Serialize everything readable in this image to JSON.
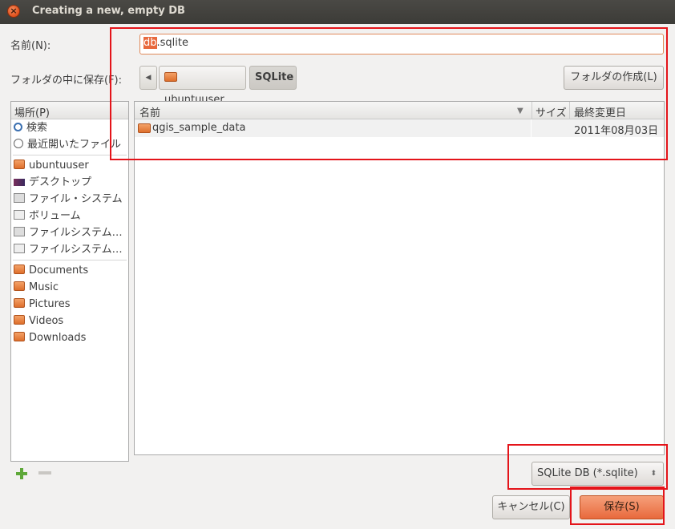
{
  "window": {
    "title": "Creating a new, empty DB",
    "close_icon": "×"
  },
  "name_field": {
    "label": "名前(N):",
    "selected_part": "db",
    "rest": ".sqlite"
  },
  "save_in": {
    "label": "フォルダの中に保存(F):",
    "crumbs": [
      "ubuntuuser",
      "SQLite"
    ],
    "create_folder_label": "フォルダの作成(L)"
  },
  "places": {
    "header": "場所(P)",
    "items": [
      {
        "label": "検索",
        "icon": "search-icon"
      },
      {
        "label": "最近開いたファイル",
        "icon": "recent-icon"
      },
      {
        "label": "ubuntuuser",
        "icon": "home-folder-icon"
      },
      {
        "label": "デスクトップ",
        "icon": "desktop-icon"
      },
      {
        "label": "ファイル・システム",
        "icon": "drive-icon"
      },
      {
        "label": "ボリューム",
        "icon": "usb-drive-icon"
      },
      {
        "label": "ファイルシステム…",
        "icon": "drive-icon"
      },
      {
        "label": "ファイルシステム…",
        "icon": "usb-drive-icon"
      },
      {
        "label": "Documents",
        "icon": "documents-folder-icon"
      },
      {
        "label": "Music",
        "icon": "music-folder-icon"
      },
      {
        "label": "Pictures",
        "icon": "pictures-folder-icon"
      },
      {
        "label": "Videos",
        "icon": "videos-folder-icon"
      },
      {
        "label": "Downloads",
        "icon": "downloads-folder-icon"
      }
    ]
  },
  "files": {
    "columns": [
      "名前",
      "サイズ",
      "最終変更日"
    ],
    "rows": [
      {
        "name": "qgis_sample_data",
        "size": "",
        "modified": "2011年08月03日"
      }
    ]
  },
  "filter": {
    "value": "SQLite DB (*.sqlite)"
  },
  "buttons": {
    "cancel": "キャンセル(C)",
    "save": "保存(S)"
  },
  "colors": {
    "accent": "#e8693d",
    "highlight_box": "#e4141a"
  }
}
